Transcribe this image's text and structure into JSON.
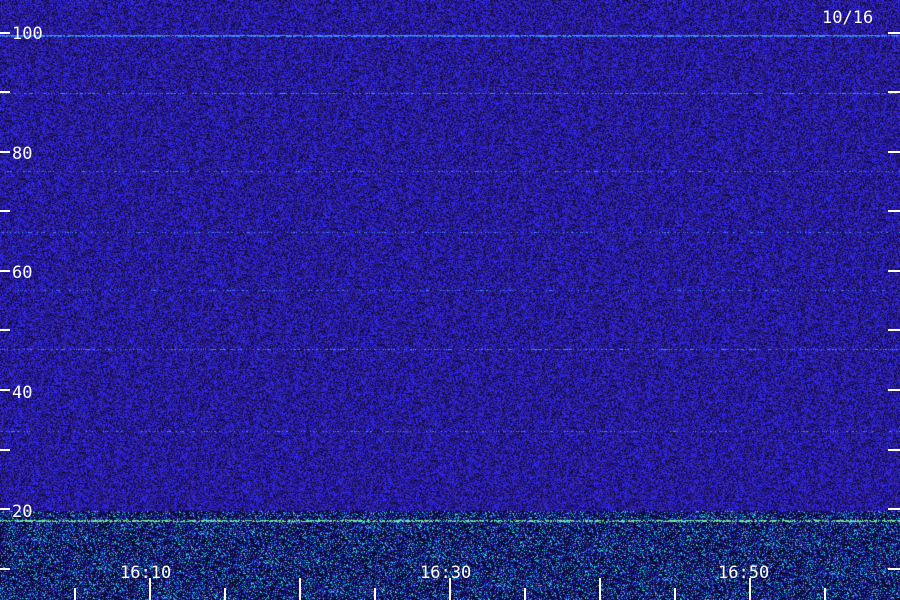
{
  "date_label": "10/16",
  "y_axis_labels": [
    "100",
    "80",
    "60",
    "40",
    "20"
  ],
  "x_axis_labels": [
    "16:10",
    "16:30",
    "16:50"
  ],
  "colors": {
    "background": "#1a0f5c",
    "noise_low": "#14104a",
    "noise_high": "#3a2ee0",
    "signal": "#4fa0ff",
    "band_highlight": "#40e0c0",
    "axis": "#ffffff"
  }
}
